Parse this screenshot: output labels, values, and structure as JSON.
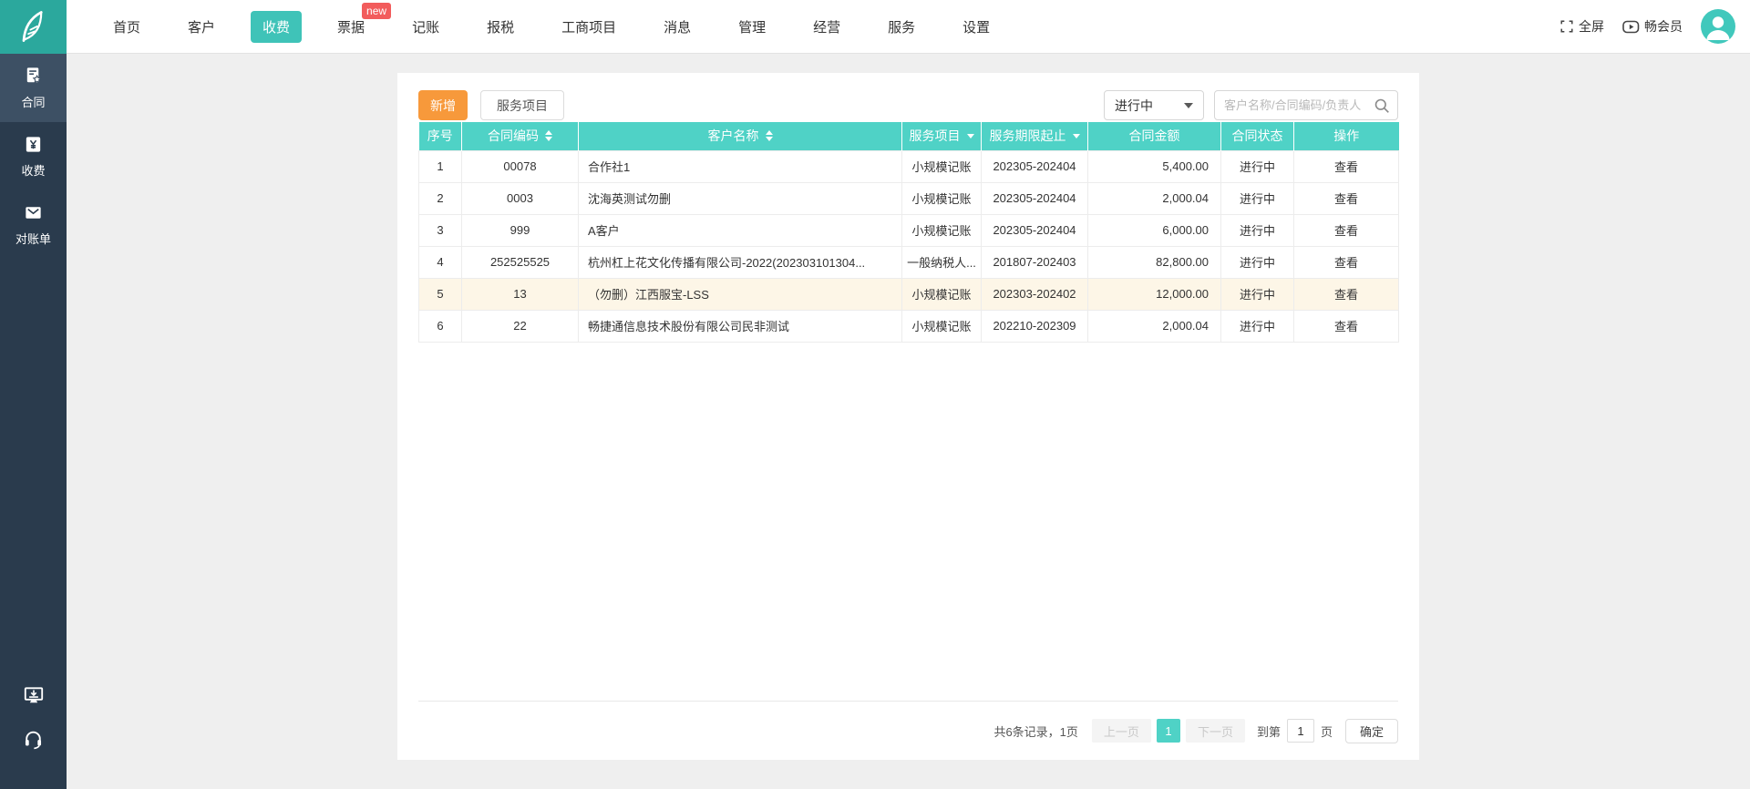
{
  "topnav": {
    "items": [
      "首页",
      "客户",
      "收费",
      "票据",
      "记账",
      "报税",
      "工商项目",
      "消息",
      "管理",
      "经营",
      "服务",
      "设置"
    ],
    "active_item": "收费",
    "badge_on": "票据",
    "badge_label": "new",
    "fullscreen_label": "全屏",
    "member_label": "畅会员"
  },
  "sidebar": {
    "items": [
      {
        "label": "合同",
        "icon": "contract-icon",
        "active": true
      },
      {
        "label": "收费",
        "icon": "fee-icon",
        "active": false
      },
      {
        "label": "对账单",
        "icon": "statement-icon",
        "active": false
      }
    ],
    "bottom_icons": [
      "client-download-icon",
      "customer-service-icon"
    ]
  },
  "toolbar": {
    "add_label": "新增",
    "service_label": "服务项目",
    "status_filter_value": "进行中",
    "search_placeholder": "客户名称/合同编码/负责人"
  },
  "table": {
    "headers": [
      "序号",
      "合同编码",
      "客户名称",
      "服务项目",
      "服务期限起止",
      "合同金额",
      "合同状态",
      "操作"
    ],
    "rows": [
      [
        "1",
        "00078",
        "合作社1",
        "小规模记账",
        "202305-202404",
        "5,400.00",
        "进行中",
        "查看"
      ],
      [
        "2",
        "0003",
        "沈海英测试勿删",
        "小规模记账",
        "202305-202404",
        "2,000.04",
        "进行中",
        "查看"
      ],
      [
        "3",
        "999",
        "A客户",
        "小规模记账",
        "202305-202404",
        "6,000.00",
        "进行中",
        "查看"
      ],
      [
        "4",
        "252525525",
        "杭州杠上花文化传播有限公司-2022(202303101304...",
        "一般纳税人...",
        "201807-202403",
        "82,800.00",
        "进行中",
        "查看"
      ],
      [
        "5",
        "13",
        "（勿删）江西服宝-LSS",
        "小规模记账",
        "202303-202402",
        "12,000.00",
        "进行中",
        "查看"
      ],
      [
        "6",
        "22",
        "畅捷通信息技术股份有限公司民非测试",
        "小规模记账",
        "202210-202309",
        "2,000.04",
        "进行中",
        "查看"
      ]
    ],
    "highlighted_row_index": 4
  },
  "pagination": {
    "summary": "共6条记录，1页",
    "prev_label": "上一页",
    "current_page": "1",
    "next_label": "下一页",
    "goto_prefix": "到第",
    "goto_value": "1",
    "goto_suffix": "页",
    "confirm_label": "确定"
  },
  "colors": {
    "brand_teal": "#2ba89d",
    "accent_teal": "#4fd2c6",
    "nav_active_teal": "#3fc3b8",
    "sidebar_dark": "#2a3b4d",
    "sidebar_active": "#3d5064",
    "add_button_orange": "#f7993b",
    "badge_red": "#f25c5c",
    "row_highlight": "#fdf6e7"
  }
}
